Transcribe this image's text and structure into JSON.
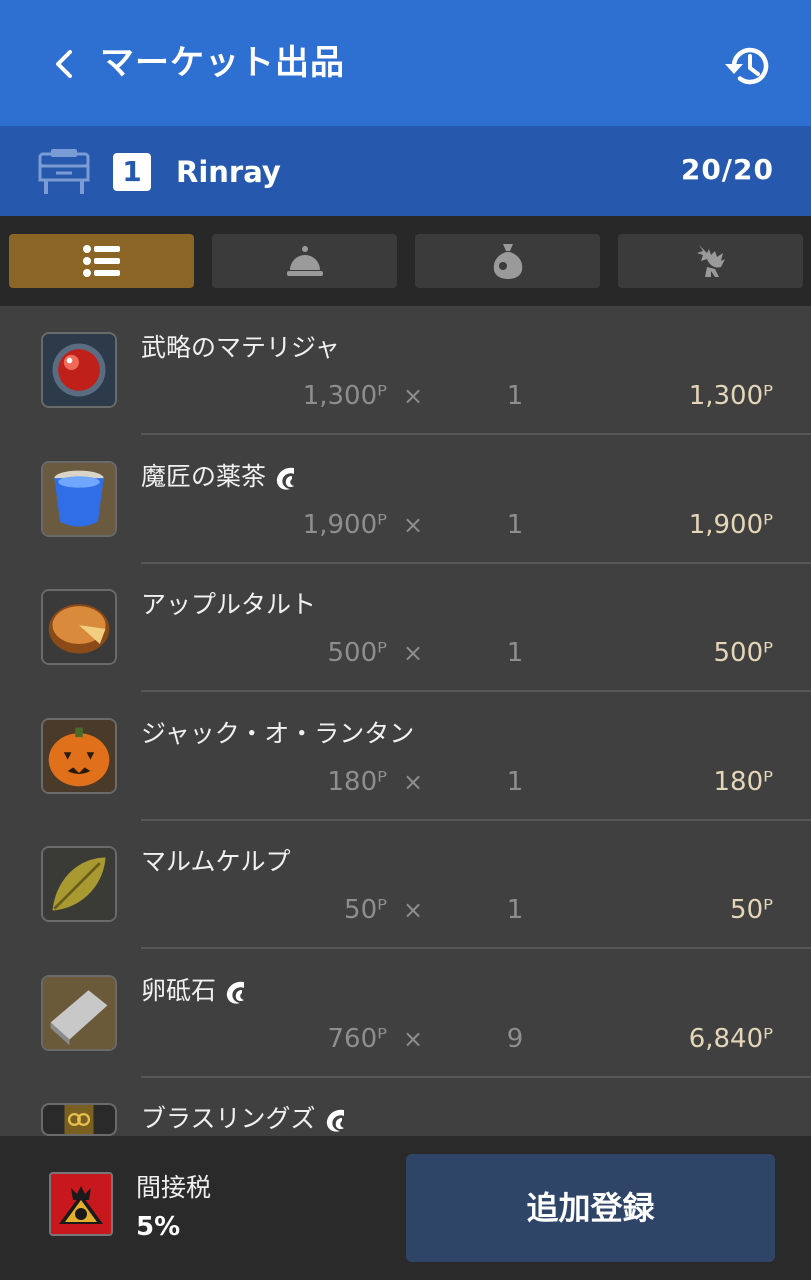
{
  "header": {
    "title": "マーケット出品",
    "back_icon": "chevron-left-icon",
    "history_icon": "history-icon"
  },
  "retainer": {
    "slot": "1",
    "name": "Rinray",
    "count": "20/20",
    "icon": "retainer-desk-icon"
  },
  "tabs": [
    {
      "icon": "list-icon",
      "active": true
    },
    {
      "icon": "service-bell-icon",
      "active": false
    },
    {
      "icon": "coin-bag-icon",
      "active": false
    },
    {
      "icon": "chocobo-icon",
      "active": false
    }
  ],
  "items": [
    {
      "name": "武略のマテリジャ",
      "hq": false,
      "unit_price": "1,300ᴾ",
      "times": "×",
      "qty": "1",
      "total": "1,300ᴾ",
      "icon": "materia-icon"
    },
    {
      "name": "魔匠の薬茶",
      "hq": true,
      "unit_price": "1,900ᴾ",
      "times": "×",
      "qty": "1",
      "total": "1,900ᴾ",
      "icon": "tea-cup-icon"
    },
    {
      "name": "アップルタルト",
      "hq": false,
      "unit_price": "500ᴾ",
      "times": "×",
      "qty": "1",
      "total": "500ᴾ",
      "icon": "apple-tart-icon"
    },
    {
      "name": "ジャック・オ・ランタン",
      "hq": false,
      "unit_price": "180ᴾ",
      "times": "×",
      "qty": "1",
      "total": "180ᴾ",
      "icon": "pumpkin-icon"
    },
    {
      "name": "マルムケルプ",
      "hq": false,
      "unit_price": "50ᴾ",
      "times": "×",
      "qty": "1",
      "total": "50ᴾ",
      "icon": "kelp-leaf-icon"
    },
    {
      "name": "卵砥石",
      "hq": true,
      "unit_price": "760ᴾ",
      "times": "×",
      "qty": "9",
      "total": "6,840ᴾ",
      "icon": "whetstone-icon"
    },
    {
      "name": "ブラスリングズ",
      "hq": true,
      "unit_price": "",
      "times": "",
      "qty": "",
      "total": "",
      "icon": "brass-rings-icon"
    }
  ],
  "footer": {
    "tax_label": "間接税",
    "tax_value": "5%",
    "tax_icon": "city-crest-icon",
    "add_button": "追加登録"
  },
  "colors": {
    "header_bg": "#2e6fd2",
    "retainer_bg": "#2659ad",
    "active_tab": "#8a6526",
    "total_text": "#e4d6b8",
    "button_bg": "#2f4568"
  }
}
